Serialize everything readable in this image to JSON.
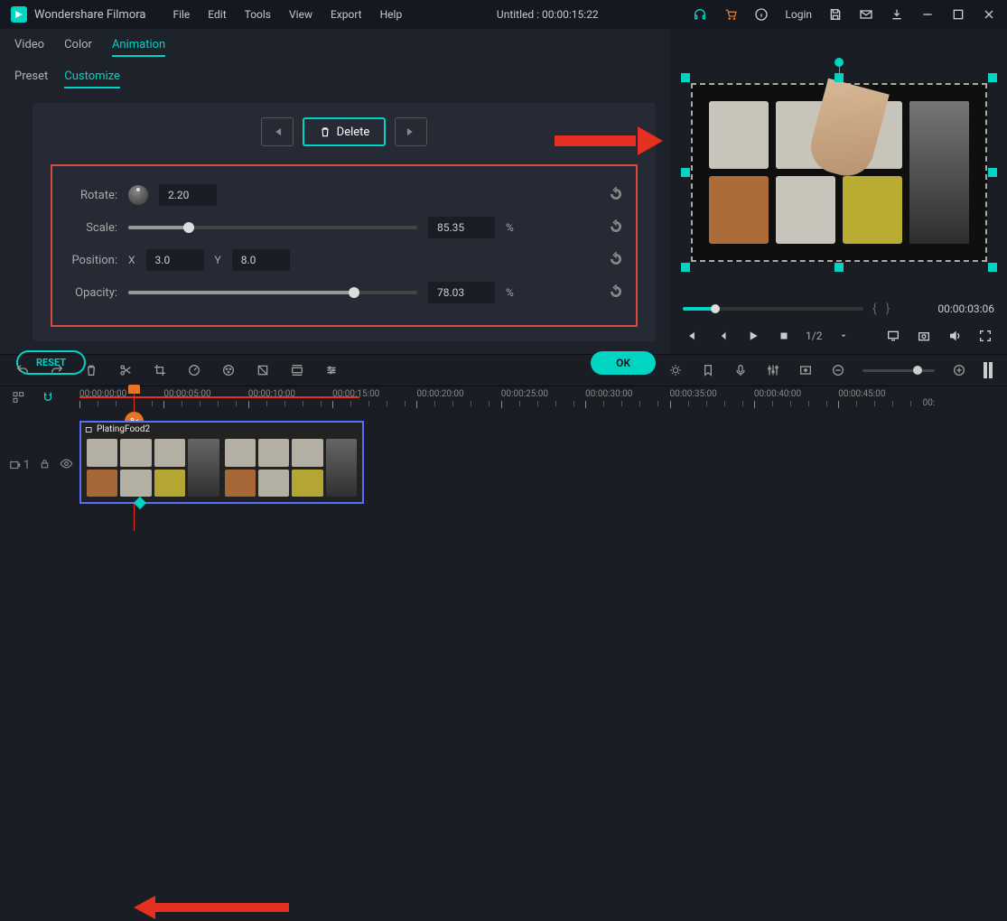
{
  "app": {
    "name": "Wondershare Filmora",
    "document_title": "Untitled : 00:00:15:22",
    "login": "Login"
  },
  "menus": [
    "File",
    "Edit",
    "Tools",
    "View",
    "Export",
    "Help"
  ],
  "top_tabs": {
    "items": [
      "Video",
      "Color",
      "Animation"
    ],
    "active": "Animation"
  },
  "sub_tabs": {
    "items": [
      "Preset",
      "Customize"
    ],
    "active": "Customize"
  },
  "keyframe_nav": {
    "delete_label": "Delete"
  },
  "properties": {
    "rotate": {
      "label": "Rotate:",
      "value": "2.20"
    },
    "scale": {
      "label": "Scale:",
      "value": "85.35",
      "unit": "%",
      "percent": 21
    },
    "position": {
      "label": "Position:",
      "x_label": "X",
      "x_value": "3.0",
      "y_label": "Y",
      "y_value": "8.0"
    },
    "opacity": {
      "label": "Opacity:",
      "value": "78.03",
      "unit": "%",
      "percent": 78
    }
  },
  "footer": {
    "reset": "RESET",
    "ok": "OK"
  },
  "preview": {
    "time": "00:00:03:06",
    "zoom_ratio": "1/2"
  },
  "ruler": {
    "labels": [
      "00:00:00:00",
      "00:00:05:00",
      "00:00:10:00",
      "00:00:15:00",
      "00:00:20:00",
      "00:00:25:00",
      "00:00:30:00",
      "00:00:35:00",
      "00:00:40:00",
      "00:00:45:00",
      "00:"
    ]
  },
  "track": {
    "head_icon_text": "1",
    "clip_name": "PlatingFood2"
  }
}
